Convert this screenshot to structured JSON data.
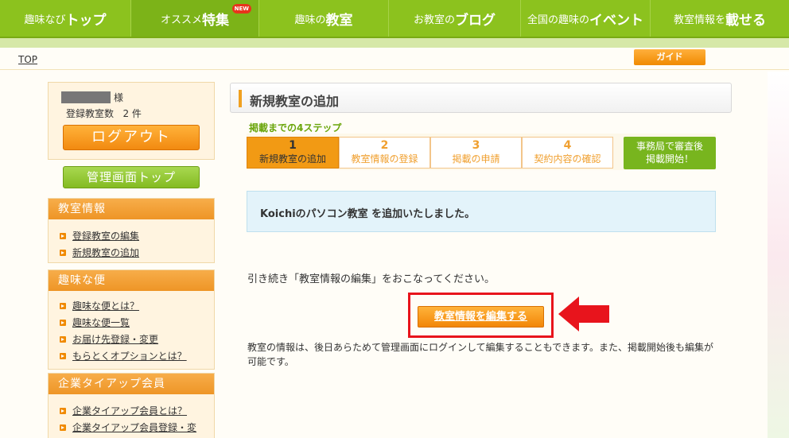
{
  "nav": {
    "items": [
      {
        "small": "趣味なび",
        "large": "トップ"
      },
      {
        "small": "オススメ",
        "large": "特集",
        "badge": "NEW"
      },
      {
        "small": "趣味の",
        "large": "教室"
      },
      {
        "small": "お教室の",
        "large": "ブログ"
      },
      {
        "small": "全国の趣味の",
        "large": "イベント"
      },
      {
        "small": "教室情報を",
        "large": "載せる"
      }
    ]
  },
  "breadcrumb": {
    "top": "TOP"
  },
  "guide_label": "ガイド",
  "user": {
    "name_suffix": "様",
    "count_label": "登録教室数",
    "count_value": "2 件"
  },
  "buttons": {
    "logout": "ログアウト",
    "admin_top": "管理画面トップ",
    "edit_info": "教室情報を編集する"
  },
  "sidebar": {
    "sections": [
      {
        "title": "教室情報",
        "links": [
          "登録教室の編集",
          "新規教室の追加"
        ]
      },
      {
        "title": "趣味な便",
        "links": [
          "趣味な便とは？",
          "趣味な便一覧",
          "お届け先登録・変更",
          "もらとくオプションとは？"
        ]
      },
      {
        "title": "企業タイアップ会員",
        "links": [
          "企業タイアップ会員とは？",
          "企業タイアップ会員登録・変"
        ]
      }
    ]
  },
  "main": {
    "page_title": "新規教室の追加",
    "steps_label": "掲載までの4ステップ",
    "steps": [
      {
        "num": "1",
        "label": "新規教室の追加"
      },
      {
        "num": "2",
        "label": "教室情報の登録"
      },
      {
        "num": "3",
        "label": "掲載の申請"
      },
      {
        "num": "4",
        "label": "契約内容の確認"
      }
    ],
    "final_step": {
      "line1": "事務局で審査後",
      "line2": "掲載開始！"
    },
    "notice": "Koichiのパソコン教室 を追加いたしました。",
    "continue_text": "引き続き「教室情報の編集」をおこなってください。",
    "info_text": "教室の情報は、後日あらためて管理画面にログインして編集することもできます。また、掲載開始後も編集が可能です。"
  },
  "colors": {
    "nav_green": "#8cc21e",
    "accent_orange": "#f29a14",
    "highlight_red": "#e8141c"
  }
}
